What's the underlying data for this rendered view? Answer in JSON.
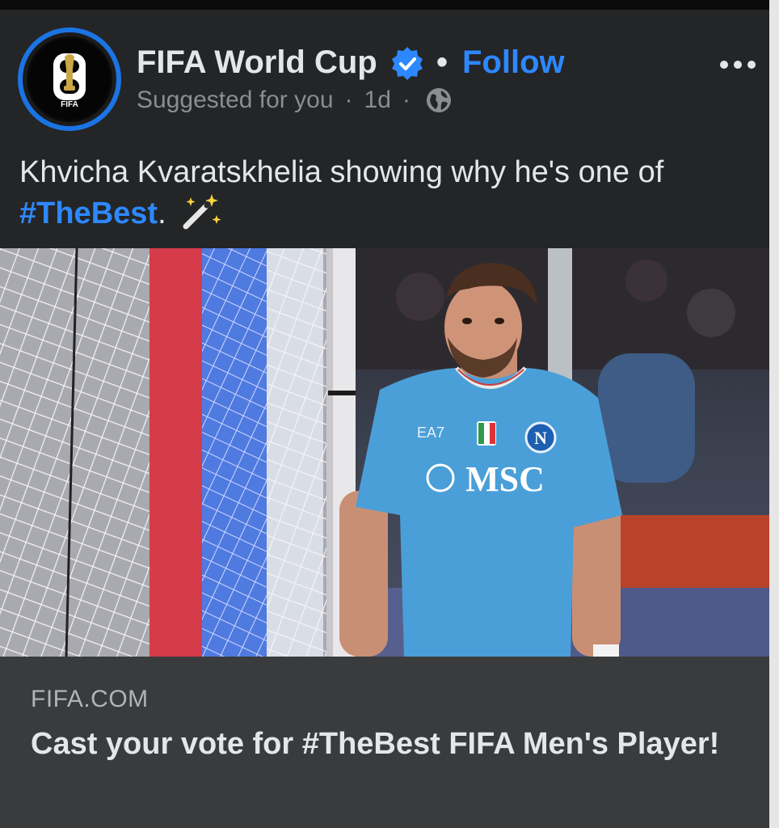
{
  "post": {
    "page_name": "FIFA World Cup",
    "follow_label": "Follow",
    "separator_dot": "•",
    "meta_suggested": "Suggested for you",
    "meta_sep": "·",
    "meta_time": "1d",
    "text_main": "Khvicha Kvaratskhelia showing why he's one of ",
    "text_hashtag": "#TheBest",
    "text_period": ".",
    "text_emoji": "✨"
  },
  "avatar": {
    "logo_number": "26",
    "logo_label": "FIFA"
  },
  "photo": {
    "shirt_brand": "EA7",
    "shirt_sponsor": "MSC",
    "crest_letter": "N"
  },
  "link_preview": {
    "domain": "FIFA.COM",
    "title": "Cast your vote for #TheBest FIFA Men's Player!"
  },
  "icons": {
    "verified": "verified-badge-icon",
    "more": "more-options-icon",
    "globe": "globe-icon"
  },
  "colors": {
    "background": "#242526",
    "link_blue": "#2d88ff",
    "avatar_ring": "#1b74e4",
    "link_card": "#3a3b3c",
    "jersey": "#4a9fd8"
  }
}
